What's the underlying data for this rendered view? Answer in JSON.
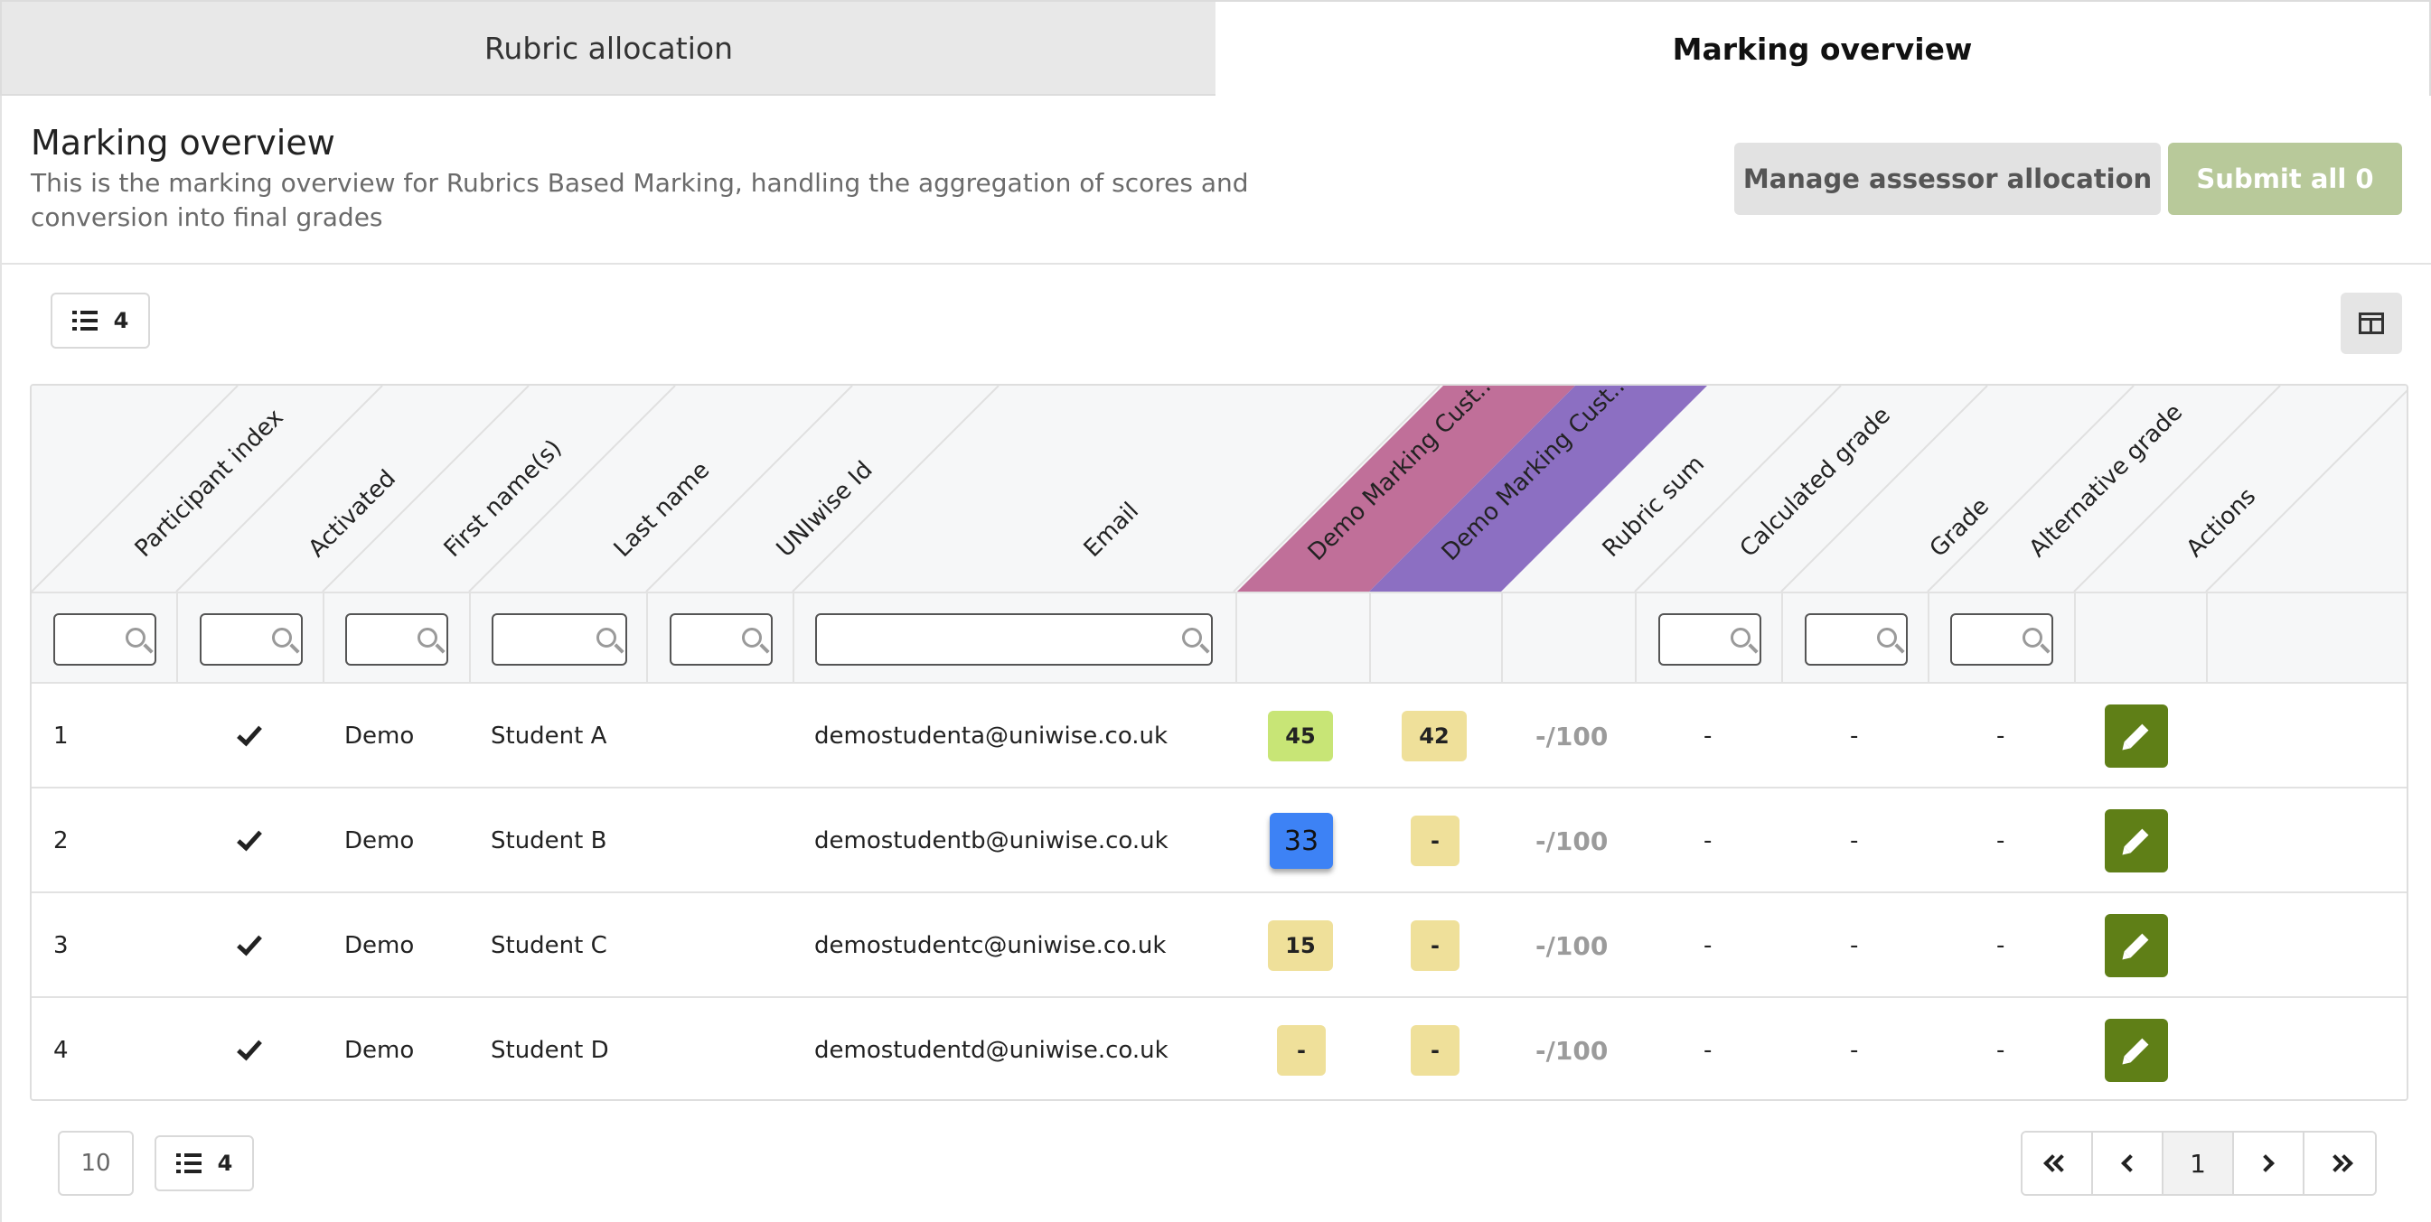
{
  "tabs": [
    {
      "label": "Rubric allocation",
      "active": false
    },
    {
      "label": "Marking overview",
      "active": true
    }
  ],
  "header": {
    "title": "Marking overview",
    "description": "This is the marking overview for Rubrics Based Marking, handling the aggregation of scores and conversion into final grades",
    "manage_button": "Manage assessor allocation",
    "submit_button": "Submit all 0"
  },
  "toolbar": {
    "row_count": "4"
  },
  "table": {
    "columns": [
      "Participant index",
      "Activated",
      "First name(s)",
      "Last name",
      "UNIwise Id",
      "Email",
      "Demo Marking Cust...",
      "Demo Marking Cust...",
      "Rubric sum",
      "Calculated grade",
      "Grade",
      "Alternative grade",
      "Actions"
    ],
    "rubric_colors": [
      "#c06f99",
      "#8c6fc2"
    ],
    "rows": [
      {
        "index": "1",
        "activated": true,
        "first": "Demo",
        "last": "Student A",
        "uniwise_id": "",
        "email": "demostudenta@uniwise.co.uk",
        "m1": "45",
        "m1_style": "g",
        "m2": "42",
        "m2_style": "y",
        "rubric_sum": "-/100",
        "calc": "-",
        "grade": "-",
        "alt": "-"
      },
      {
        "index": "2",
        "activated": true,
        "first": "Demo",
        "last": "Student B",
        "uniwise_id": "",
        "email": "demostudentb@uniwise.co.uk",
        "m1": "33",
        "m1_style": "b",
        "m2": "-",
        "m2_style": "y",
        "rubric_sum": "-/100",
        "calc": "-",
        "grade": "-",
        "alt": "-"
      },
      {
        "index": "3",
        "activated": true,
        "first": "Demo",
        "last": "Student C",
        "uniwise_id": "",
        "email": "demostudentc@uniwise.co.uk",
        "m1": "15",
        "m1_style": "y",
        "m2": "-",
        "m2_style": "y",
        "rubric_sum": "-/100",
        "calc": "-",
        "grade": "-",
        "alt": "-"
      },
      {
        "index": "4",
        "activated": true,
        "first": "Demo",
        "last": "Student D",
        "uniwise_id": "",
        "email": "demostudentd@uniwise.co.uk",
        "m1": "-",
        "m1_style": "y",
        "m2": "-",
        "m2_style": "y",
        "rubric_sum": "-/100",
        "calc": "-",
        "grade": "-",
        "alt": "-"
      }
    ]
  },
  "footer": {
    "page_size": "10",
    "row_count": "4",
    "current_page": "1"
  },
  "icons": [
    "list-icon",
    "columns-icon",
    "search-icon",
    "check-icon",
    "edit-icon",
    "first-page-icon",
    "prev-page-icon",
    "next-page-icon",
    "last-page-icon"
  ]
}
